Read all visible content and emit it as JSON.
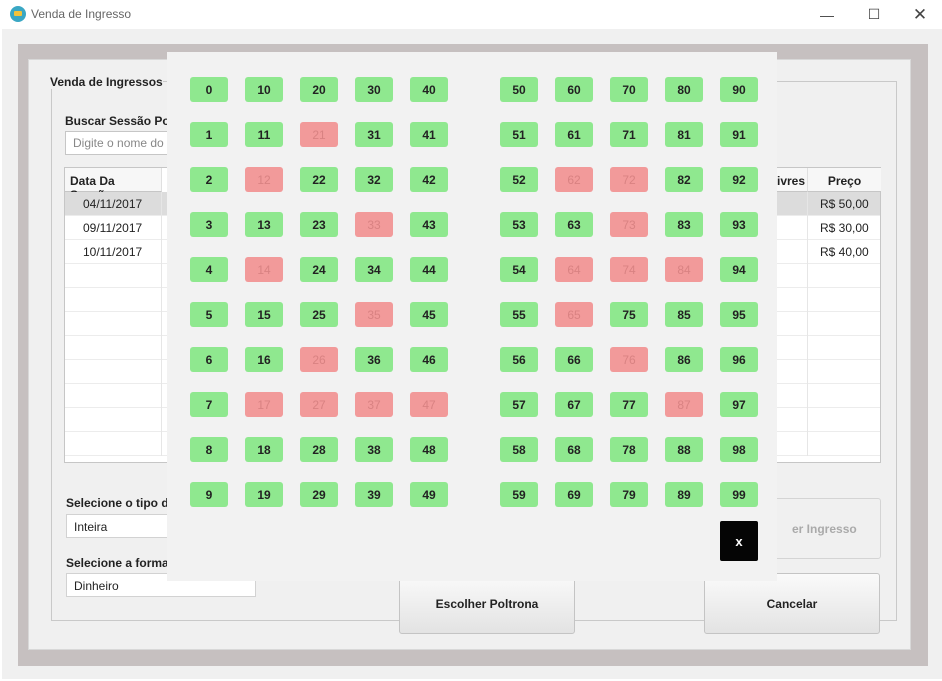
{
  "window": {
    "title": "Venda de Ingresso",
    "icon": "ticket-icon",
    "controls": {
      "minimize": "—",
      "maximize": "☐",
      "close": "✕"
    }
  },
  "form": {
    "group_title": "Venda de Ingressos",
    "search_label": "Buscar Sessão Po",
    "search_placeholder": "Digite o nome do"
  },
  "table": {
    "headers": {
      "date": "Data Da Sessão",
      "livres": "ivres",
      "price": "Preço"
    },
    "rows": [
      {
        "date": "04/11/2017",
        "price": "R$ 50,00",
        "selected": true
      },
      {
        "date": "09/11/2017",
        "price": "R$ 30,00",
        "selected": false
      },
      {
        "date": "10/11/2017",
        "price": "R$ 40,00",
        "selected": false
      },
      {
        "date": "",
        "price": ""
      },
      {
        "date": "",
        "price": ""
      },
      {
        "date": "",
        "price": ""
      },
      {
        "date": "",
        "price": ""
      },
      {
        "date": "",
        "price": ""
      },
      {
        "date": "",
        "price": ""
      },
      {
        "date": "",
        "price": ""
      },
      {
        "date": "",
        "price": ""
      }
    ]
  },
  "ticket_type": {
    "label": "Selecione o tipo d",
    "value": "Inteira"
  },
  "payment": {
    "label": "Selecione a forma",
    "value": "Dinheiro"
  },
  "buttons": {
    "ingresso": "er Ingresso",
    "poltrona": "Escolher Poltrona",
    "cancelar": "Cancelar"
  },
  "seat_picker": {
    "close_label": "x",
    "available_color": "#8fe88f",
    "occupied_color": "#f29a9a",
    "columns": [
      {
        "seats": [
          0,
          1,
          2,
          3,
          4,
          5,
          6,
          7,
          8,
          9
        ],
        "occupied": []
      },
      {
        "seats": [
          10,
          11,
          12,
          13,
          14,
          15,
          16,
          17,
          18,
          19
        ],
        "occupied": [
          12,
          14,
          17
        ]
      },
      {
        "seats": [
          20,
          21,
          22,
          23,
          24,
          25,
          26,
          27,
          28,
          29
        ],
        "occupied": [
          21,
          26,
          27
        ]
      },
      {
        "seats": [
          30,
          31,
          32,
          33,
          34,
          35,
          36,
          37,
          38,
          39
        ],
        "occupied": [
          33,
          35,
          37
        ]
      },
      {
        "seats": [
          40,
          41,
          42,
          43,
          44,
          45,
          46,
          47,
          48,
          49
        ],
        "occupied": [
          47
        ]
      },
      {
        "seats": [
          50,
          51,
          52,
          53,
          54,
          55,
          56,
          57,
          58,
          59
        ],
        "occupied": []
      },
      {
        "seats": [
          60,
          61,
          62,
          63,
          64,
          65,
          66,
          67,
          68,
          69
        ],
        "occupied": [
          62,
          64,
          65
        ]
      },
      {
        "seats": [
          70,
          71,
          72,
          73,
          74,
          75,
          76,
          77,
          78,
          79
        ],
        "occupied": [
          72,
          73,
          74,
          76
        ]
      },
      {
        "seats": [
          80,
          81,
          82,
          83,
          84,
          85,
          86,
          87,
          88,
          89
        ],
        "occupied": [
          84,
          87
        ]
      },
      {
        "seats": [
          90,
          91,
          92,
          93,
          94,
          95,
          96,
          97,
          98,
          99
        ],
        "occupied": []
      }
    ]
  }
}
